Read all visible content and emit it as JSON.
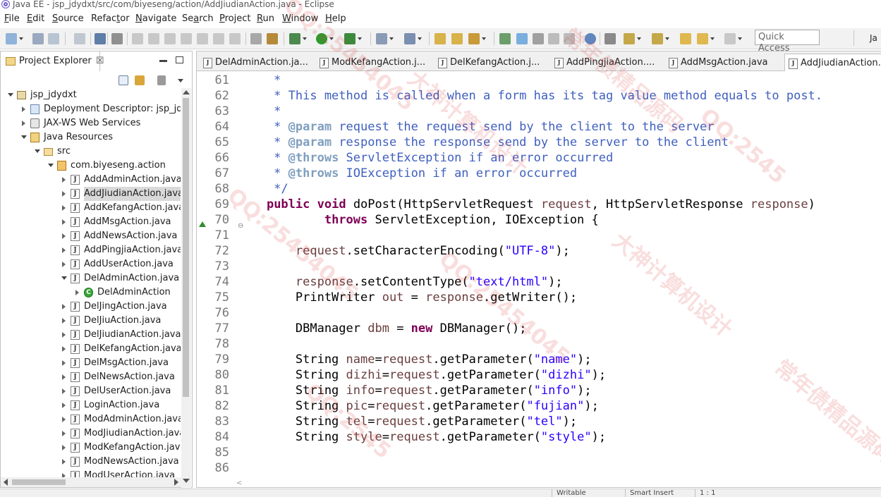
{
  "window": {
    "title": "Java EE - jsp_jdydxt/src/com/biyeseng/action/AddJiudianAction.java - Eclipse"
  },
  "menubar": [
    {
      "label": "File",
      "mnemonic": "F",
      "rest": "ile"
    },
    {
      "label": "Edit",
      "mnemonic": "E",
      "rest": "dit"
    },
    {
      "label": "Source",
      "mnemonic": "S",
      "rest": "ource"
    },
    {
      "label": "Refactor",
      "mnemonic": "t",
      "pre": "Refac",
      "rest": "or"
    },
    {
      "label": "Navigate",
      "mnemonic": "N",
      "rest": "avigate"
    },
    {
      "label": "Search",
      "mnemonic": "a",
      "pre": "Se",
      "rest": "rch"
    },
    {
      "label": "Project",
      "mnemonic": "P",
      "rest": "roject"
    },
    {
      "label": "Run",
      "mnemonic": "R",
      "rest": "un"
    },
    {
      "label": "Window",
      "mnemonic": "W",
      "rest": "indow"
    },
    {
      "label": "Help",
      "mnemonic": "H",
      "rest": "elp"
    }
  ],
  "toolbar": {
    "quick_access_placeholder": "Quick Access",
    "perspective_label": "Ja"
  },
  "explorer": {
    "tab_title": "Project Explorer",
    "tab_close": "☒",
    "tree": [
      {
        "label": "jsp_jdydxt",
        "icon": "project-icon",
        "expanded": true
      },
      {
        "label": "Deployment Descriptor: jsp_jdyd",
        "icon": "deployment-descriptor-icon",
        "expanded": false
      },
      {
        "label": "JAX-WS Web Services",
        "icon": "web-services-icon",
        "expanded": false
      },
      {
        "label": "Java Resources",
        "icon": "java-resources-icon",
        "expanded": true
      },
      {
        "label": "src",
        "icon": "source-folder-icon",
        "expanded": true
      },
      {
        "label": "com.biyeseng.action",
        "icon": "package-icon",
        "expanded": true
      },
      {
        "label": "AddAdminAction.java",
        "icon": "java-file-icon",
        "expanded": false
      },
      {
        "label": "AddJiudianAction.java",
        "icon": "java-file-icon",
        "expanded": false,
        "selected": true
      },
      {
        "label": "AddKefangAction.java",
        "icon": "java-file-icon",
        "expanded": false
      },
      {
        "label": "AddMsgAction.java",
        "icon": "java-file-icon",
        "expanded": false
      },
      {
        "label": "AddNewsAction.java",
        "icon": "java-file-icon",
        "expanded": false
      },
      {
        "label": "AddPingjiaAction.java",
        "icon": "java-file-icon",
        "expanded": false
      },
      {
        "label": "AddUserAction.java",
        "icon": "java-file-icon",
        "expanded": false
      },
      {
        "label": "DelAdminAction.java",
        "icon": "java-file-icon",
        "expanded": true
      },
      {
        "label": "DelAdminAction",
        "icon": "class-icon",
        "expanded": false
      },
      {
        "label": "DelJingAction.java",
        "icon": "java-file-icon",
        "expanded": false
      },
      {
        "label": "DelJiuAction.java",
        "icon": "java-file-icon",
        "expanded": false
      },
      {
        "label": "DelJiudianAction.java",
        "icon": "java-file-icon",
        "expanded": false
      },
      {
        "label": "DelKefangAction.java",
        "icon": "java-file-icon",
        "expanded": false
      },
      {
        "label": "DelMsgAction.java",
        "icon": "java-file-icon",
        "expanded": false
      },
      {
        "label": "DelNewsAction.java",
        "icon": "java-file-icon",
        "expanded": false
      },
      {
        "label": "DelUserAction.java",
        "icon": "java-file-icon",
        "expanded": false
      },
      {
        "label": "LoginAction.java",
        "icon": "java-file-icon",
        "expanded": false
      },
      {
        "label": "ModAdminAction.java",
        "icon": "java-file-icon",
        "expanded": false
      },
      {
        "label": "ModJiudianAction.java",
        "icon": "java-file-icon",
        "expanded": false
      },
      {
        "label": "ModKefangAction.java",
        "icon": "java-file-icon",
        "expanded": false
      },
      {
        "label": "ModNewsAction.java",
        "icon": "java-file-icon",
        "expanded": false
      },
      {
        "label": "ModUserAction.java",
        "icon": "java-file-icon",
        "expanded": false
      }
    ]
  },
  "editor": {
    "tabs": [
      {
        "label": "DelAdminAction.ja..."
      },
      {
        "label": "ModKefangAction.j..."
      },
      {
        "label": "DelKefangAction.j..."
      },
      {
        "label": "AddPingjiaAction...."
      },
      {
        "label": "AddMsgAction.java"
      },
      {
        "label": "AddJiudianAction....",
        "active": true
      }
    ],
    "lines": [
      {
        "num": "61",
        "tokens": [
          {
            "t": "     *",
            "c": "doc"
          }
        ]
      },
      {
        "num": "62",
        "tokens": [
          {
            "t": "     * This method is called when a form has its tag value method equals to post.",
            "c": "doc"
          }
        ]
      },
      {
        "num": "63",
        "tokens": [
          {
            "t": "     *",
            "c": "doc"
          }
        ]
      },
      {
        "num": "64",
        "tokens": [
          {
            "t": "     * ",
            "c": "doc"
          },
          {
            "t": "@param",
            "c": "tag"
          },
          {
            "t": " request the request send by the client to the server",
            "c": "doc"
          }
        ]
      },
      {
        "num": "65",
        "tokens": [
          {
            "t": "     * ",
            "c": "doc"
          },
          {
            "t": "@param",
            "c": "tag"
          },
          {
            "t": " response the response send by the server to the client",
            "c": "doc"
          }
        ]
      },
      {
        "num": "66",
        "tokens": [
          {
            "t": "     * ",
            "c": "doc"
          },
          {
            "t": "@throws",
            "c": "tag"
          },
          {
            "t": " ServletException if an error occurred",
            "c": "doc"
          }
        ]
      },
      {
        "num": "67",
        "tokens": [
          {
            "t": "     * ",
            "c": "doc"
          },
          {
            "t": "@throws",
            "c": "tag"
          },
          {
            "t": " IOException if an error occurred",
            "c": "doc"
          }
        ]
      },
      {
        "num": "68",
        "tokens": [
          {
            "t": "     */",
            "c": "doc"
          }
        ]
      },
      {
        "num": "69",
        "tokens": [
          {
            "t": "    ",
            "c": "plain"
          },
          {
            "t": "public",
            "c": "kw"
          },
          {
            "t": " ",
            "c": "plain"
          },
          {
            "t": "void",
            "c": "kw"
          },
          {
            "t": " doPost(HttpServletRequest ",
            "c": "plain"
          },
          {
            "t": "request",
            "c": "var"
          },
          {
            "t": ", HttpServletResponse ",
            "c": "plain"
          },
          {
            "t": "response",
            "c": "var"
          },
          {
            "t": ")",
            "c": "plain"
          }
        ]
      },
      {
        "num": "70",
        "tokens": [
          {
            "t": "            ",
            "c": "plain"
          },
          {
            "t": "throws",
            "c": "kw"
          },
          {
            "t": " ServletException, IOException {",
            "c": "plain"
          }
        ]
      },
      {
        "num": "71",
        "tokens": [
          {
            "t": "",
            "c": "plain"
          }
        ]
      },
      {
        "num": "72",
        "tokens": [
          {
            "t": "        ",
            "c": "plain"
          },
          {
            "t": "request",
            "c": "var"
          },
          {
            "t": ".setCharacterEncoding(",
            "c": "plain"
          },
          {
            "t": "\"UTF-8\"",
            "c": "str"
          },
          {
            "t": ");",
            "c": "plain"
          }
        ]
      },
      {
        "num": "73",
        "tokens": [
          {
            "t": "",
            "c": "plain"
          }
        ]
      },
      {
        "num": "74",
        "tokens": [
          {
            "t": "        ",
            "c": "plain"
          },
          {
            "t": "response",
            "c": "var"
          },
          {
            "t": ".setContentType(",
            "c": "plain"
          },
          {
            "t": "\"text/html\"",
            "c": "str"
          },
          {
            "t": ");",
            "c": "plain"
          }
        ]
      },
      {
        "num": "75",
        "tokens": [
          {
            "t": "        PrintWriter ",
            "c": "plain"
          },
          {
            "t": "out",
            "c": "var"
          },
          {
            "t": " = ",
            "c": "plain"
          },
          {
            "t": "response",
            "c": "var"
          },
          {
            "t": ".getWriter();",
            "c": "plain"
          }
        ]
      },
      {
        "num": "76",
        "tokens": [
          {
            "t": "",
            "c": "plain"
          }
        ]
      },
      {
        "num": "77",
        "tokens": [
          {
            "t": "        DBManager ",
            "c": "plain"
          },
          {
            "t": "dbm",
            "c": "var"
          },
          {
            "t": " = ",
            "c": "plain"
          },
          {
            "t": "new",
            "c": "kw"
          },
          {
            "t": " DBManager();",
            "c": "plain"
          }
        ]
      },
      {
        "num": "78",
        "tokens": [
          {
            "t": "",
            "c": "plain"
          }
        ]
      },
      {
        "num": "79",
        "tokens": [
          {
            "t": "        String ",
            "c": "plain"
          },
          {
            "t": "name",
            "c": "var"
          },
          {
            "t": "=",
            "c": "plain"
          },
          {
            "t": "request",
            "c": "var"
          },
          {
            "t": ".getParameter(",
            "c": "plain"
          },
          {
            "t": "\"name\"",
            "c": "str"
          },
          {
            "t": ");",
            "c": "plain"
          }
        ]
      },
      {
        "num": "80",
        "tokens": [
          {
            "t": "        String ",
            "c": "plain"
          },
          {
            "t": "dizhi",
            "c": "var"
          },
          {
            "t": "=",
            "c": "plain"
          },
          {
            "t": "request",
            "c": "var"
          },
          {
            "t": ".getParameter(",
            "c": "plain"
          },
          {
            "t": "\"dizhi\"",
            "c": "str"
          },
          {
            "t": ");",
            "c": "plain"
          }
        ]
      },
      {
        "num": "81",
        "tokens": [
          {
            "t": "        String ",
            "c": "plain"
          },
          {
            "t": "info",
            "c": "var"
          },
          {
            "t": "=",
            "c": "plain"
          },
          {
            "t": "request",
            "c": "var"
          },
          {
            "t": ".getParameter(",
            "c": "plain"
          },
          {
            "t": "\"info\"",
            "c": "str"
          },
          {
            "t": ");",
            "c": "plain"
          }
        ]
      },
      {
        "num": "82",
        "tokens": [
          {
            "t": "        String ",
            "c": "plain"
          },
          {
            "t": "pic",
            "c": "var"
          },
          {
            "t": "=",
            "c": "plain"
          },
          {
            "t": "request",
            "c": "var"
          },
          {
            "t": ".getParameter(",
            "c": "plain"
          },
          {
            "t": "\"fujian\"",
            "c": "str"
          },
          {
            "t": ");",
            "c": "plain"
          }
        ]
      },
      {
        "num": "83",
        "tokens": [
          {
            "t": "        String ",
            "c": "plain"
          },
          {
            "t": "tel",
            "c": "var"
          },
          {
            "t": "=",
            "c": "plain"
          },
          {
            "t": "request",
            "c": "var"
          },
          {
            "t": ".getParameter(",
            "c": "plain"
          },
          {
            "t": "\"tel\"",
            "c": "str"
          },
          {
            "t": ");",
            "c": "plain"
          }
        ]
      },
      {
        "num": "84",
        "tokens": [
          {
            "t": "        String ",
            "c": "plain"
          },
          {
            "t": "style",
            "c": "var"
          },
          {
            "t": "=",
            "c": "plain"
          },
          {
            "t": "request",
            "c": "var"
          },
          {
            "t": ".getParameter(",
            "c": "plain"
          },
          {
            "t": "\"style\"",
            "c": "str"
          },
          {
            "t": ");",
            "c": "plain"
          }
        ]
      },
      {
        "num": "85",
        "tokens": [
          {
            "t": "",
            "c": "plain"
          }
        ]
      },
      {
        "num": "86",
        "tokens": [
          {
            "t": "",
            "c": "plain"
          }
        ]
      }
    ]
  },
  "statusbar": {
    "fields": [
      "Writable",
      "Smart Insert",
      "1 : 1"
    ]
  },
  "watermark": {
    "lines": [
      "QQ:25454045",
      "大神计算机设计",
      "常年债精品源码",
      "QQ:2545",
      "QQ:25454045"
    ]
  },
  "colors": {
    "keyword": "#7f0055",
    "string": "#2a00ff",
    "javadoc": "#3f5fbf",
    "javadoc_tag": "#7f9fbf",
    "local_variable": "#6a3e3e",
    "selection": "#d9d9d9"
  }
}
